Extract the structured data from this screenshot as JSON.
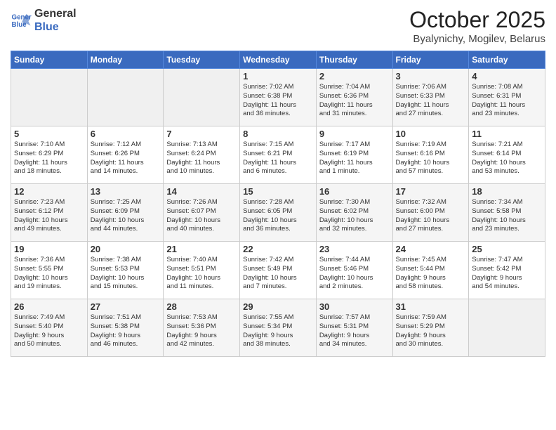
{
  "logo": {
    "line1": "General",
    "line2": "Blue"
  },
  "title": "October 2025",
  "subtitle": "Byalynichy, Mogilev, Belarus",
  "days_of_week": [
    "Sunday",
    "Monday",
    "Tuesday",
    "Wednesday",
    "Thursday",
    "Friday",
    "Saturday"
  ],
  "weeks": [
    [
      {
        "day": "",
        "info": ""
      },
      {
        "day": "",
        "info": ""
      },
      {
        "day": "",
        "info": ""
      },
      {
        "day": "1",
        "info": "Sunrise: 7:02 AM\nSunset: 6:38 PM\nDaylight: 11 hours\nand 36 minutes."
      },
      {
        "day": "2",
        "info": "Sunrise: 7:04 AM\nSunset: 6:36 PM\nDaylight: 11 hours\nand 31 minutes."
      },
      {
        "day": "3",
        "info": "Sunrise: 7:06 AM\nSunset: 6:33 PM\nDaylight: 11 hours\nand 27 minutes."
      },
      {
        "day": "4",
        "info": "Sunrise: 7:08 AM\nSunset: 6:31 PM\nDaylight: 11 hours\nand 23 minutes."
      }
    ],
    [
      {
        "day": "5",
        "info": "Sunrise: 7:10 AM\nSunset: 6:29 PM\nDaylight: 11 hours\nand 18 minutes."
      },
      {
        "day": "6",
        "info": "Sunrise: 7:12 AM\nSunset: 6:26 PM\nDaylight: 11 hours\nand 14 minutes."
      },
      {
        "day": "7",
        "info": "Sunrise: 7:13 AM\nSunset: 6:24 PM\nDaylight: 11 hours\nand 10 minutes."
      },
      {
        "day": "8",
        "info": "Sunrise: 7:15 AM\nSunset: 6:21 PM\nDaylight: 11 hours\nand 6 minutes."
      },
      {
        "day": "9",
        "info": "Sunrise: 7:17 AM\nSunset: 6:19 PM\nDaylight: 11 hours\nand 1 minute."
      },
      {
        "day": "10",
        "info": "Sunrise: 7:19 AM\nSunset: 6:16 PM\nDaylight: 10 hours\nand 57 minutes."
      },
      {
        "day": "11",
        "info": "Sunrise: 7:21 AM\nSunset: 6:14 PM\nDaylight: 10 hours\nand 53 minutes."
      }
    ],
    [
      {
        "day": "12",
        "info": "Sunrise: 7:23 AM\nSunset: 6:12 PM\nDaylight: 10 hours\nand 49 minutes."
      },
      {
        "day": "13",
        "info": "Sunrise: 7:25 AM\nSunset: 6:09 PM\nDaylight: 10 hours\nand 44 minutes."
      },
      {
        "day": "14",
        "info": "Sunrise: 7:26 AM\nSunset: 6:07 PM\nDaylight: 10 hours\nand 40 minutes."
      },
      {
        "day": "15",
        "info": "Sunrise: 7:28 AM\nSunset: 6:05 PM\nDaylight: 10 hours\nand 36 minutes."
      },
      {
        "day": "16",
        "info": "Sunrise: 7:30 AM\nSunset: 6:02 PM\nDaylight: 10 hours\nand 32 minutes."
      },
      {
        "day": "17",
        "info": "Sunrise: 7:32 AM\nSunset: 6:00 PM\nDaylight: 10 hours\nand 27 minutes."
      },
      {
        "day": "18",
        "info": "Sunrise: 7:34 AM\nSunset: 5:58 PM\nDaylight: 10 hours\nand 23 minutes."
      }
    ],
    [
      {
        "day": "19",
        "info": "Sunrise: 7:36 AM\nSunset: 5:55 PM\nDaylight: 10 hours\nand 19 minutes."
      },
      {
        "day": "20",
        "info": "Sunrise: 7:38 AM\nSunset: 5:53 PM\nDaylight: 10 hours\nand 15 minutes."
      },
      {
        "day": "21",
        "info": "Sunrise: 7:40 AM\nSunset: 5:51 PM\nDaylight: 10 hours\nand 11 minutes."
      },
      {
        "day": "22",
        "info": "Sunrise: 7:42 AM\nSunset: 5:49 PM\nDaylight: 10 hours\nand 7 minutes."
      },
      {
        "day": "23",
        "info": "Sunrise: 7:44 AM\nSunset: 5:46 PM\nDaylight: 10 hours\nand 2 minutes."
      },
      {
        "day": "24",
        "info": "Sunrise: 7:45 AM\nSunset: 5:44 PM\nDaylight: 9 hours\nand 58 minutes."
      },
      {
        "day": "25",
        "info": "Sunrise: 7:47 AM\nSunset: 5:42 PM\nDaylight: 9 hours\nand 54 minutes."
      }
    ],
    [
      {
        "day": "26",
        "info": "Sunrise: 7:49 AM\nSunset: 5:40 PM\nDaylight: 9 hours\nand 50 minutes."
      },
      {
        "day": "27",
        "info": "Sunrise: 7:51 AM\nSunset: 5:38 PM\nDaylight: 9 hours\nand 46 minutes."
      },
      {
        "day": "28",
        "info": "Sunrise: 7:53 AM\nSunset: 5:36 PM\nDaylight: 9 hours\nand 42 minutes."
      },
      {
        "day": "29",
        "info": "Sunrise: 7:55 AM\nSunset: 5:34 PM\nDaylight: 9 hours\nand 38 minutes."
      },
      {
        "day": "30",
        "info": "Sunrise: 7:57 AM\nSunset: 5:31 PM\nDaylight: 9 hours\nand 34 minutes."
      },
      {
        "day": "31",
        "info": "Sunrise: 7:59 AM\nSunset: 5:29 PM\nDaylight: 9 hours\nand 30 minutes."
      },
      {
        "day": "",
        "info": ""
      }
    ]
  ]
}
